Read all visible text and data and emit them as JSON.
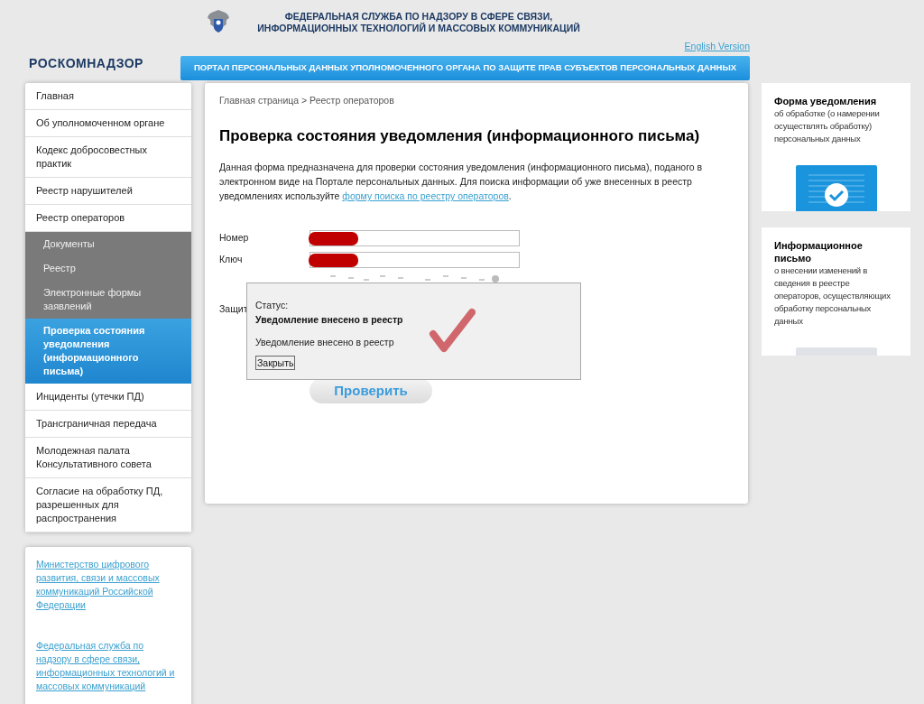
{
  "header": {
    "agency_title": "ФЕДЕРАЛЬНАЯ СЛУЖБА ПО НАДЗОРУ В СФЕРЕ СВЯЗИ, ИНФОРМАЦИОННЫХ ТЕХНОЛОГИЙ И МАССОВЫХ КОММУНИКАЦИЙ",
    "logo_text": "РОСКОМНАДЗОР",
    "language_link": "English Version",
    "banner": "ПОРТАЛ ПЕРСОНАЛЬНЫХ ДАННЫХ УПОЛНОМОЧЕННОГО ОРГАНА ПО ЗАЩИТЕ ПРАВ СУБЪЕКТОВ ПЕРСОНАЛЬНЫХ ДАННЫХ"
  },
  "sidebar": {
    "items": [
      {
        "label": "Главная",
        "selected": false
      },
      {
        "label": "Об уполномоченном органе",
        "selected": false
      },
      {
        "label": "Кодекс добросовестных практик",
        "selected": false
      },
      {
        "label": "Реестр нарушителей",
        "selected": false
      },
      {
        "label": "Реестр операторов",
        "selected": false,
        "expanded": true,
        "children": [
          {
            "label": "Документы",
            "selected": false
          },
          {
            "label": "Реестр",
            "selected": false
          },
          {
            "label": "Электронные формы заявлений",
            "selected": false
          },
          {
            "label": "Проверка состояния уведомления (информационного письма)",
            "selected": true
          }
        ]
      },
      {
        "label": "Инциденты (утечки ПД)",
        "selected": false
      },
      {
        "label": "Трансграничная передача",
        "selected": false
      },
      {
        "label": "Молодежная палата Консультативного совета",
        "selected": false
      },
      {
        "label": "Согласие на обработку ПД, разрешенных для распространения",
        "selected": false
      }
    ],
    "links": [
      "Министерство цифрового развития, связи и массовых коммуникаций Российской Федерации",
      "Федеральная служба по надзору в сфере связи, информационных технологий и массовых коммуникаций"
    ]
  },
  "main": {
    "breadcrumb": "Главная страница > Реестр операторов",
    "title": "Проверка состояния уведомления (информационного письма)",
    "intro": "Данная форма предназначена для проверки состояния уведомления (информационного письма), поданого в электронном виде на Портале персональных данных. Для поиска информации об уже внесенных в реестр уведомлениях используйте ",
    "intro_link": "форму поиска по реестру операторов",
    "intro_end": ".",
    "fields": [
      {
        "label": "Номер",
        "redacted": true
      },
      {
        "label": "Ключ",
        "redacted": true
      }
    ],
    "captcha_label": "Защит",
    "submit": "Проверить"
  },
  "dialog": {
    "status_label": "Статус:",
    "status": "Уведомление внесено в реестр",
    "message": "Уведомление внесено в реестр",
    "close": "Закрыть"
  },
  "cards": [
    {
      "kind": "check",
      "title": "Форма уведомления",
      "text": "об обработке (о намерении осуществлять обработку) персональных данных"
    },
    {
      "kind": "edit",
      "title": "Информационное письмо",
      "text": "о внесении изменений в сведения в реестре операторов, осуществляющих обработку персональных данных"
    }
  ]
}
